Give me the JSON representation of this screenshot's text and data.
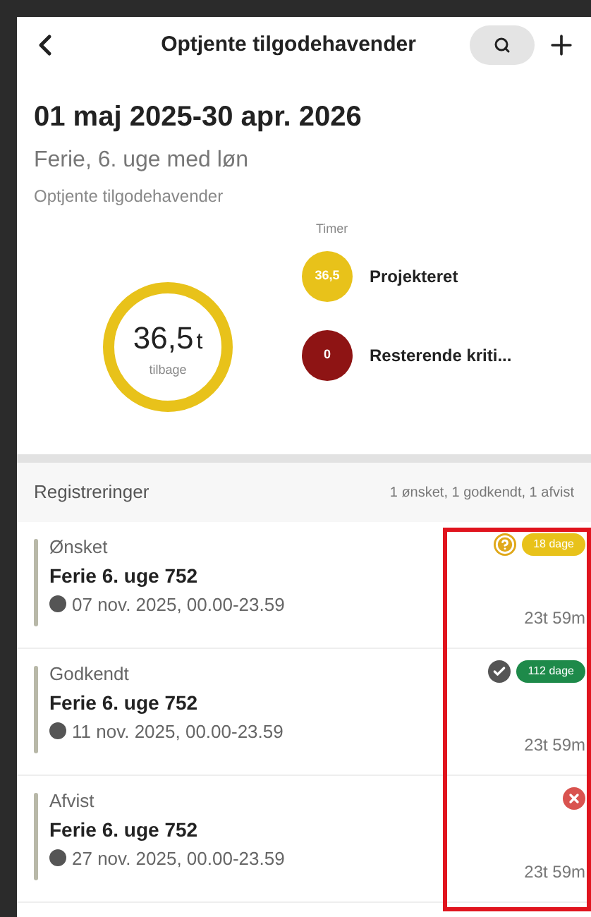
{
  "header": {
    "title": "Optjente tilgodehavender"
  },
  "period": "01 maj 2025-30 apr. 2026",
  "type": "Ferie, 6. uge med løn",
  "section_label": "Optjente tilgodehavender",
  "summary": {
    "value": "36,5",
    "unit": "t",
    "caption": "tilbage",
    "legend_title": "Timer",
    "legend": [
      {
        "value": "36,5",
        "label": "Projekteret",
        "color": "#e8c21a"
      },
      {
        "value": "0",
        "label": "Resterende kriti...",
        "color": "#8e1414"
      }
    ]
  },
  "registrations": {
    "title": "Registreringer",
    "counts": "1 ønsket, 1 godkendt, 1 afvist",
    "items": [
      {
        "status": "Ønsket",
        "kind": "pending",
        "name": "Ferie 6. uge 752",
        "date": "07 nov. 2025, 00.00-23.59",
        "badge": "18 dage",
        "color": "#e8c21a",
        "duration": "23t 59m"
      },
      {
        "status": "Godkendt",
        "kind": "approved",
        "name": "Ferie 6. uge 752",
        "date": "11 nov. 2025, 00.00-23.59",
        "badge": "112 dage",
        "color": "#1e8a4a",
        "duration": "23t 59m"
      },
      {
        "status": "Afvist",
        "kind": "rejected",
        "name": "Ferie 6. uge 752",
        "date": "27 nov. 2025, 00.00-23.59",
        "duration": "23t 59m"
      }
    ]
  }
}
